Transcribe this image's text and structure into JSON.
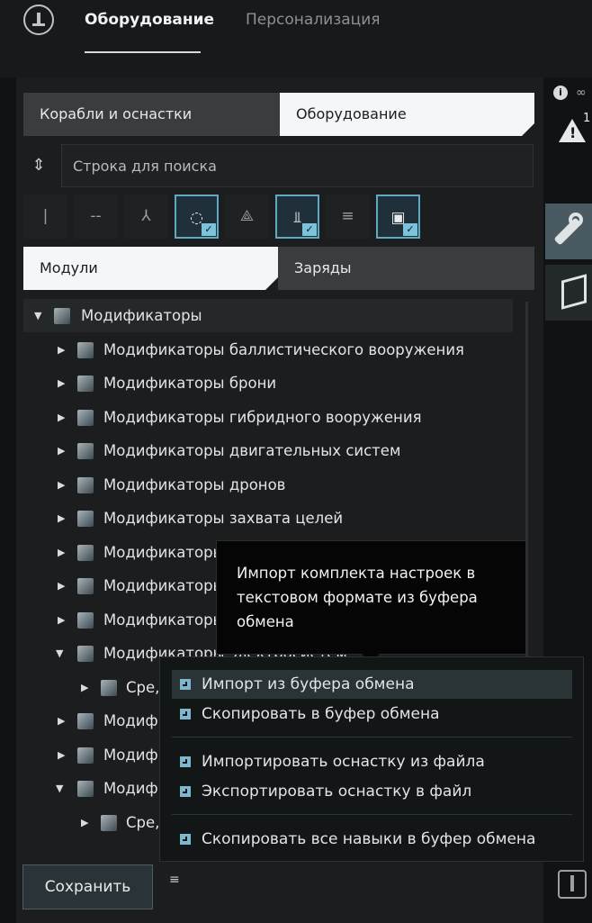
{
  "top_tabs": [
    "Оборудование",
    "Персонализация"
  ],
  "segment1": {
    "left": "Корабли и оснастки",
    "right": "Оборудование"
  },
  "search": {
    "placeholder": "Строка для поиска"
  },
  "filters": [
    {
      "icon": "small-weapon-icon",
      "glyph": "|",
      "active": false
    },
    {
      "icon": "medium-weapon-icon",
      "glyph": "--",
      "active": false
    },
    {
      "icon": "drone-icon",
      "glyph": "⅄",
      "active": false
    },
    {
      "icon": "hull-icon",
      "glyph": "◌",
      "active": true
    },
    {
      "icon": "skill-icon",
      "glyph": "⟁",
      "active": false
    },
    {
      "icon": "fitting-icon",
      "glyph": "⫫",
      "active": true
    },
    {
      "icon": "list-icon",
      "glyph": "≡",
      "active": false
    },
    {
      "icon": "cube-icon",
      "glyph": "▣",
      "active": true
    }
  ],
  "segment2": {
    "left": "Модули",
    "right": "Заряды"
  },
  "tree": {
    "root": "Модификаторы",
    "items": [
      "Модификаторы баллистического вооружения",
      "Модификаторы брони",
      "Модификаторы гибридного вооружения",
      "Модификаторы двигательных систем",
      "Модификаторы дронов",
      "Модификаторы захвата целей",
      "Модификаторы инженерных систем",
      "Модификаторы лазерного вооружения",
      "Модификаторы обработки",
      "Модификаторы электросистем",
      "Сре,",
      "Модиф",
      "Модиф",
      "Модиф",
      "Сре,"
    ]
  },
  "save_label": "Сохранить",
  "tooltip": "Импорт комплекта настроек в текстовом формате из буфера обмена",
  "context_menu": [
    "Импорт из буфера обмена",
    "Скопировать в буфер обмена",
    "Импортировать оснастку из файла",
    "Экспортировать оснастку в файл",
    "Скопировать все навыки в буфер обмена"
  ],
  "warning_count": "1"
}
